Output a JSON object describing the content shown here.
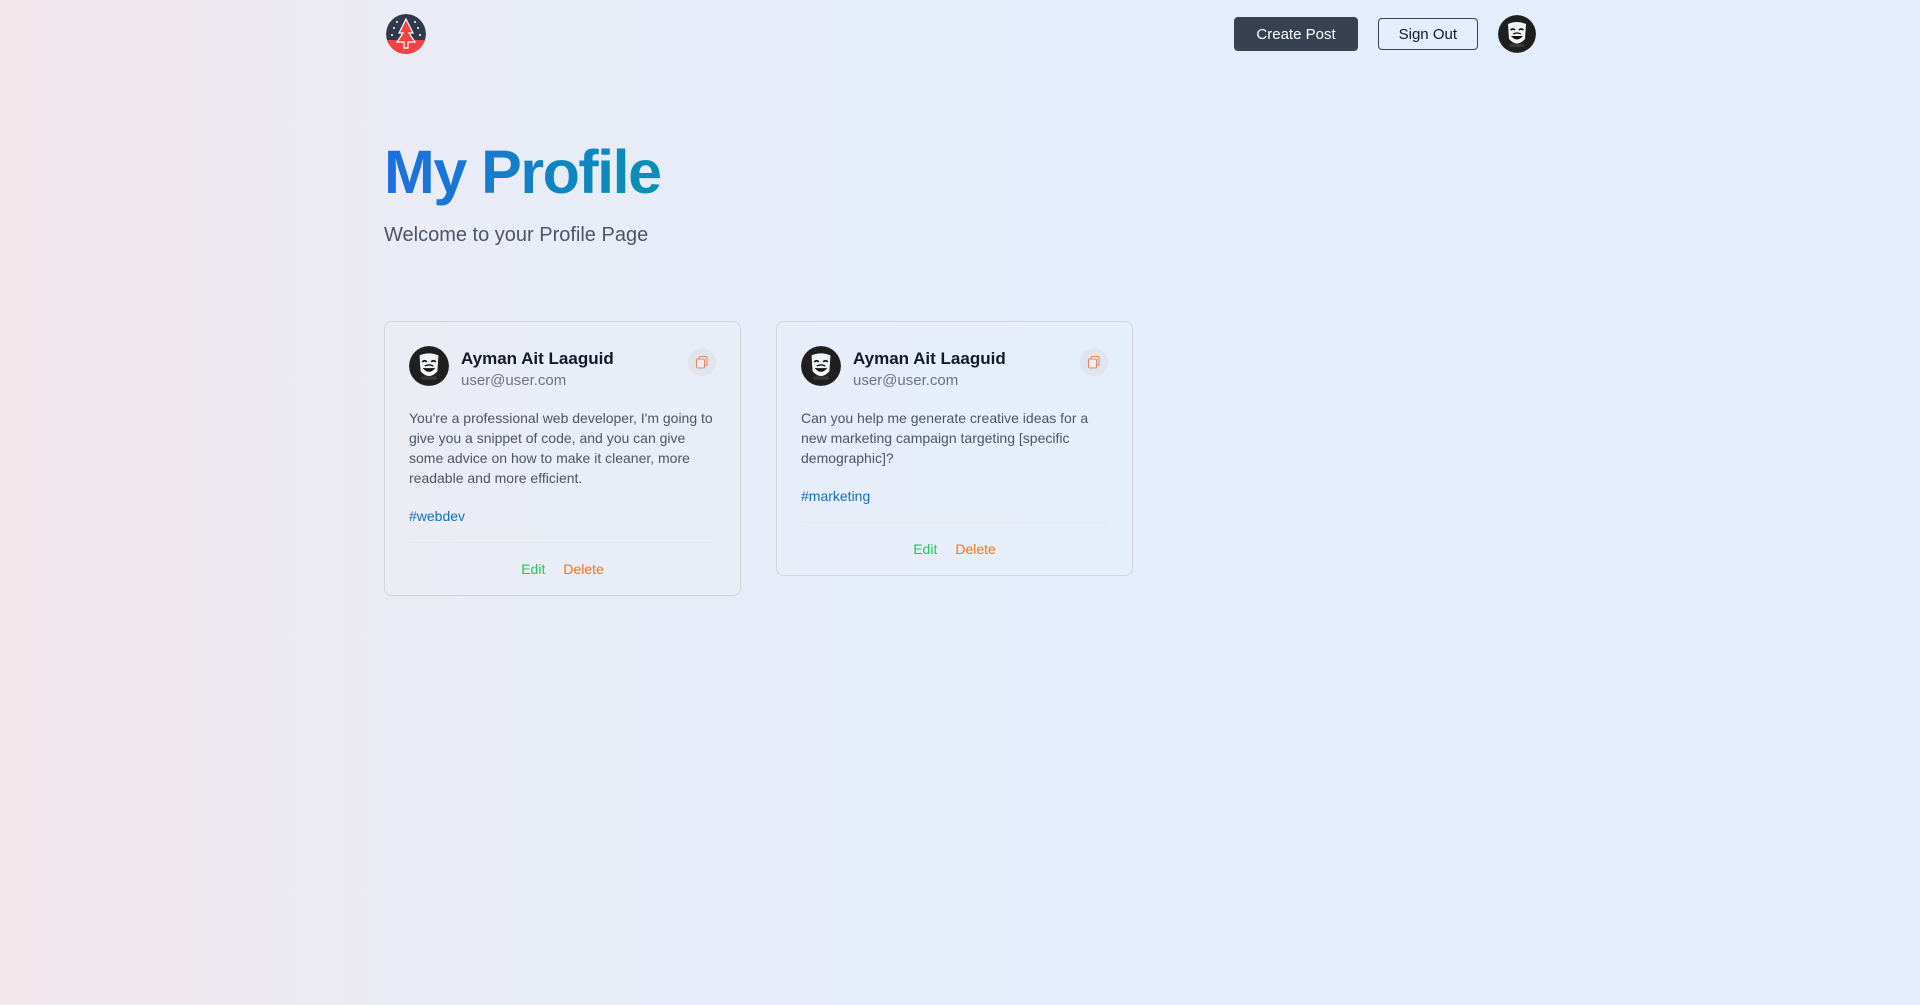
{
  "nav": {
    "logo_icon": "logo-icon",
    "create_post_label": "Create Post",
    "sign_out_label": "Sign Out",
    "avatar_icon": "mask-avatar-icon"
  },
  "page": {
    "title": "My Profile",
    "subtitle": "Welcome to your Profile Page"
  },
  "posts": [
    {
      "author_name": "Ayman Ait Laaguid",
      "author_email": "user@user.com",
      "text": "You're a professional web developer, I'm going to give you a snippet of code, and you can give some advice on how to make it cleaner, more readable and more efficient.",
      "tag": "#webdev",
      "edit_label": "Edit",
      "delete_label": "Delete"
    },
    {
      "author_name": "Ayman Ait Laaguid",
      "author_email": "user@user.com",
      "text": "Can you help me generate creative ideas for a new marketing campaign targeting [specific demographic]?",
      "tag": "#marketing",
      "edit_label": "Edit",
      "delete_label": "Delete"
    }
  ],
  "colors": {
    "title_gradient_start": "#1d6fe0",
    "title_gradient_end": "#0891b2",
    "primary_button": "#374151",
    "edit": "#22c55e",
    "delete": "#f97316",
    "tag": "#0f72b8"
  }
}
